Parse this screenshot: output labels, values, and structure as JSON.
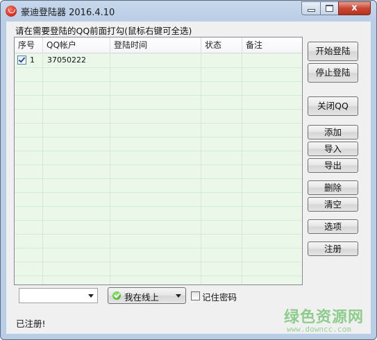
{
  "window": {
    "title": "豪迪登陆器 2016.4.10",
    "close_glyph": "x",
    "icons": {
      "app": "app-logo-icon",
      "minimize": "minimize-icon",
      "maximize": "maximize-icon",
      "close": "close-icon"
    }
  },
  "instructions": "请在需要登陆的QQ前面打勾(鼠标右键可全选)",
  "table": {
    "columns": [
      "序号",
      "QQ帐户",
      "登陆时间",
      "状态",
      "备注"
    ],
    "rows": [
      {
        "checked": true,
        "index": "1",
        "account": "37050222",
        "login_time": "",
        "status": "",
        "note": ""
      }
    ],
    "background": "#ebf8e9"
  },
  "buttons": {
    "start_login": "开始登陆",
    "stop_login": "停止登陆",
    "close_qq": "关闭QQ",
    "add": "添加",
    "import": "导入",
    "export": "导出",
    "delete": "删除",
    "clear": "清空",
    "options": "选项",
    "register": "注册"
  },
  "bottom": {
    "account_select_value": "",
    "status_select_value": "我在线上",
    "status_icon": "online-status-icon",
    "remember_password_label": "记住密码",
    "remember_password_checked": false,
    "status_text": "已注册!"
  },
  "watermark": {
    "text": "绿色资源网",
    "url": "www.downcc.com"
  }
}
